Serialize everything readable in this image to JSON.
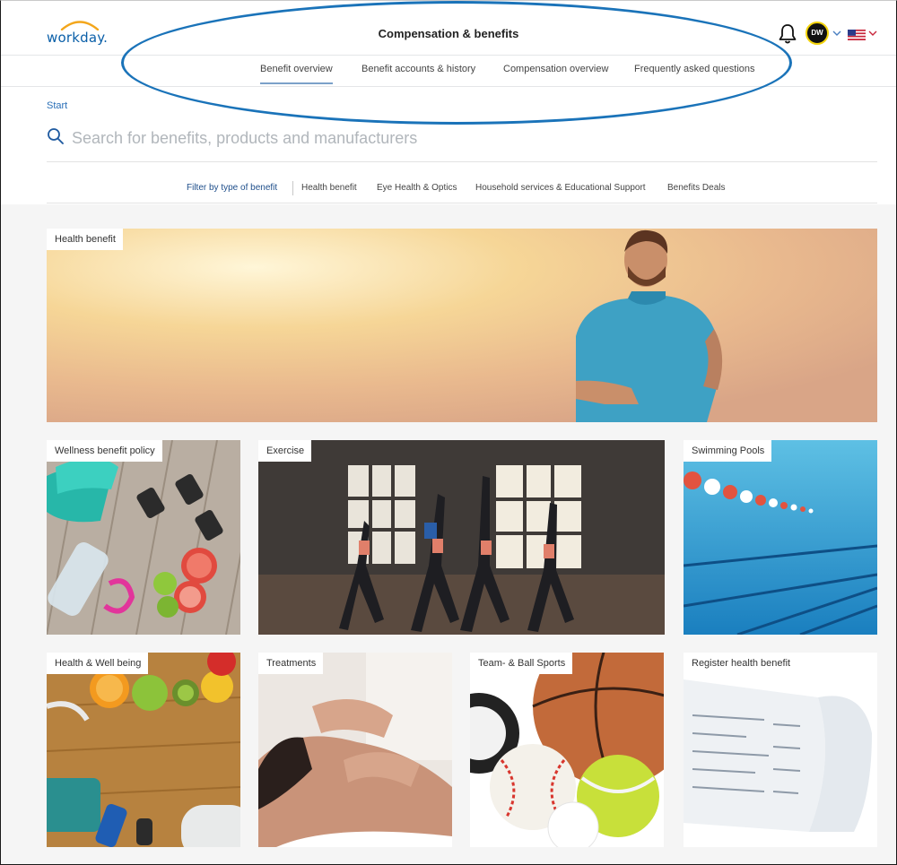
{
  "header": {
    "logo_text": "workday.",
    "page_title": "Compensation & benefits",
    "avatar_initials": "DW"
  },
  "tabs": [
    {
      "label": "Benefit overview",
      "active": true
    },
    {
      "label": "Benefit accounts & history",
      "active": false
    },
    {
      "label": "Compensation overview",
      "active": false
    },
    {
      "label": "Frequently asked questions",
      "active": false
    }
  ],
  "breadcrumb": "Start",
  "search": {
    "placeholder": "Search for benefits, products and manufacturers"
  },
  "filters": {
    "lead": "Filter by type of benefit",
    "items": [
      "Health benefit",
      "Eye Health & Optics",
      "Household services & Educational Support",
      "Benefits Deals"
    ]
  },
  "tiles": [
    {
      "label": "Health benefit"
    },
    {
      "label": "Wellness benefit policy"
    },
    {
      "label": "Exercise"
    },
    {
      "label": "Swimming Pools"
    },
    {
      "label": "Health & Well being"
    },
    {
      "label": "Treatments"
    },
    {
      "label": "Team- & Ball Sports"
    },
    {
      "label": "Register health benefit"
    }
  ],
  "colors": {
    "brand_blue": "#0a5fa8",
    "link_blue": "#2a6fb7",
    "highlight_ellipse": "#1a73b9",
    "active_tab_underline": "#7ba1c9"
  }
}
